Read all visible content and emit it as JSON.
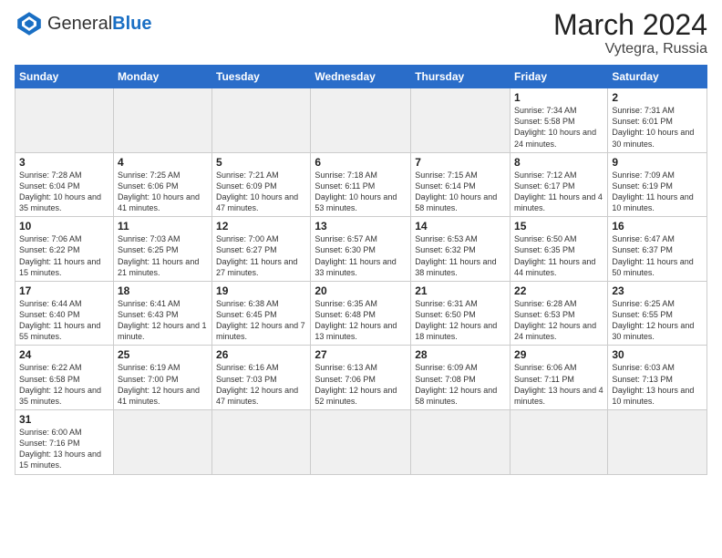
{
  "header": {
    "logo_general": "General",
    "logo_blue": "Blue",
    "month_year": "March 2024",
    "location": "Vytegra, Russia"
  },
  "weekdays": [
    "Sunday",
    "Monday",
    "Tuesday",
    "Wednesday",
    "Thursday",
    "Friday",
    "Saturday"
  ],
  "weeks": [
    [
      {
        "day": "",
        "info": ""
      },
      {
        "day": "",
        "info": ""
      },
      {
        "day": "",
        "info": ""
      },
      {
        "day": "",
        "info": ""
      },
      {
        "day": "",
        "info": ""
      },
      {
        "day": "1",
        "info": "Sunrise: 7:34 AM\nSunset: 5:58 PM\nDaylight: 10 hours\nand 24 minutes."
      },
      {
        "day": "2",
        "info": "Sunrise: 7:31 AM\nSunset: 6:01 PM\nDaylight: 10 hours\nand 30 minutes."
      }
    ],
    [
      {
        "day": "3",
        "info": "Sunrise: 7:28 AM\nSunset: 6:04 PM\nDaylight: 10 hours\nand 35 minutes."
      },
      {
        "day": "4",
        "info": "Sunrise: 7:25 AM\nSunset: 6:06 PM\nDaylight: 10 hours\nand 41 minutes."
      },
      {
        "day": "5",
        "info": "Sunrise: 7:21 AM\nSunset: 6:09 PM\nDaylight: 10 hours\nand 47 minutes."
      },
      {
        "day": "6",
        "info": "Sunrise: 7:18 AM\nSunset: 6:11 PM\nDaylight: 10 hours\nand 53 minutes."
      },
      {
        "day": "7",
        "info": "Sunrise: 7:15 AM\nSunset: 6:14 PM\nDaylight: 10 hours\nand 58 minutes."
      },
      {
        "day": "8",
        "info": "Sunrise: 7:12 AM\nSunset: 6:17 PM\nDaylight: 11 hours\nand 4 minutes."
      },
      {
        "day": "9",
        "info": "Sunrise: 7:09 AM\nSunset: 6:19 PM\nDaylight: 11 hours\nand 10 minutes."
      }
    ],
    [
      {
        "day": "10",
        "info": "Sunrise: 7:06 AM\nSunset: 6:22 PM\nDaylight: 11 hours\nand 15 minutes."
      },
      {
        "day": "11",
        "info": "Sunrise: 7:03 AM\nSunset: 6:25 PM\nDaylight: 11 hours\nand 21 minutes."
      },
      {
        "day": "12",
        "info": "Sunrise: 7:00 AM\nSunset: 6:27 PM\nDaylight: 11 hours\nand 27 minutes."
      },
      {
        "day": "13",
        "info": "Sunrise: 6:57 AM\nSunset: 6:30 PM\nDaylight: 11 hours\nand 33 minutes."
      },
      {
        "day": "14",
        "info": "Sunrise: 6:53 AM\nSunset: 6:32 PM\nDaylight: 11 hours\nand 38 minutes."
      },
      {
        "day": "15",
        "info": "Sunrise: 6:50 AM\nSunset: 6:35 PM\nDaylight: 11 hours\nand 44 minutes."
      },
      {
        "day": "16",
        "info": "Sunrise: 6:47 AM\nSunset: 6:37 PM\nDaylight: 11 hours\nand 50 minutes."
      }
    ],
    [
      {
        "day": "17",
        "info": "Sunrise: 6:44 AM\nSunset: 6:40 PM\nDaylight: 11 hours\nand 55 minutes."
      },
      {
        "day": "18",
        "info": "Sunrise: 6:41 AM\nSunset: 6:43 PM\nDaylight: 12 hours\nand 1 minute."
      },
      {
        "day": "19",
        "info": "Sunrise: 6:38 AM\nSunset: 6:45 PM\nDaylight: 12 hours\nand 7 minutes."
      },
      {
        "day": "20",
        "info": "Sunrise: 6:35 AM\nSunset: 6:48 PM\nDaylight: 12 hours\nand 13 minutes."
      },
      {
        "day": "21",
        "info": "Sunrise: 6:31 AM\nSunset: 6:50 PM\nDaylight: 12 hours\nand 18 minutes."
      },
      {
        "day": "22",
        "info": "Sunrise: 6:28 AM\nSunset: 6:53 PM\nDaylight: 12 hours\nand 24 minutes."
      },
      {
        "day": "23",
        "info": "Sunrise: 6:25 AM\nSunset: 6:55 PM\nDaylight: 12 hours\nand 30 minutes."
      }
    ],
    [
      {
        "day": "24",
        "info": "Sunrise: 6:22 AM\nSunset: 6:58 PM\nDaylight: 12 hours\nand 35 minutes."
      },
      {
        "day": "25",
        "info": "Sunrise: 6:19 AM\nSunset: 7:00 PM\nDaylight: 12 hours\nand 41 minutes."
      },
      {
        "day": "26",
        "info": "Sunrise: 6:16 AM\nSunset: 7:03 PM\nDaylight: 12 hours\nand 47 minutes."
      },
      {
        "day": "27",
        "info": "Sunrise: 6:13 AM\nSunset: 7:06 PM\nDaylight: 12 hours\nand 52 minutes."
      },
      {
        "day": "28",
        "info": "Sunrise: 6:09 AM\nSunset: 7:08 PM\nDaylight: 12 hours\nand 58 minutes."
      },
      {
        "day": "29",
        "info": "Sunrise: 6:06 AM\nSunset: 7:11 PM\nDaylight: 13 hours\nand 4 minutes."
      },
      {
        "day": "30",
        "info": "Sunrise: 6:03 AM\nSunset: 7:13 PM\nDaylight: 13 hours\nand 10 minutes."
      }
    ],
    [
      {
        "day": "31",
        "info": "Sunrise: 6:00 AM\nSunset: 7:16 PM\nDaylight: 13 hours\nand 15 minutes."
      },
      {
        "day": "",
        "info": ""
      },
      {
        "day": "",
        "info": ""
      },
      {
        "day": "",
        "info": ""
      },
      {
        "day": "",
        "info": ""
      },
      {
        "day": "",
        "info": ""
      },
      {
        "day": "",
        "info": ""
      }
    ]
  ]
}
